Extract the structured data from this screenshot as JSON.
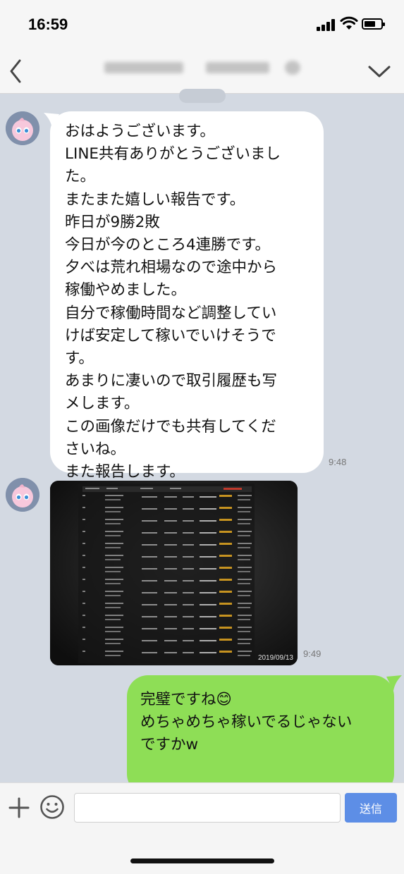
{
  "status_bar": {
    "time": "16:59"
  },
  "header": {
    "back_icon": "chevron-left-icon",
    "menu_icon": "chevron-down-icon"
  },
  "messages": [
    {
      "sender": "other",
      "lines": [
        "おはようございます。",
        "LINE共有ありがとうございまし",
        "た。",
        "またまた嬉しい報告です。",
        "昨日が9勝2敗",
        "今日が今のところ4連勝です。",
        "夕べは荒れ相場なので途中から",
        "稼働やめました。",
        "自分で稼働時間など調整してい",
        "けば安定して稼いでいけそうで",
        "す。",
        "あまりに凄いので取引履歴も写",
        "メします。",
        "この画像だけでも共有してくだ",
        "さいね。",
        "また報告します。"
      ],
      "time": "9:48"
    },
    {
      "sender": "other",
      "type": "image",
      "image_date": "2019/09/13",
      "time": "9:49"
    },
    {
      "sender": "me",
      "lines": [
        "完璧ですね😊",
        "めちゃめちゃ稼いでるじゃない",
        "ですかw"
      ]
    }
  ],
  "input_bar": {
    "placeholder": "",
    "send_label": "送信",
    "plus_icon": "plus-icon",
    "emoji_icon": "emoji-icon"
  },
  "colors": {
    "chat_background": "#d3d9e2",
    "my_bubble": "#8ede56",
    "other_bubble": "#ffffff",
    "send_button": "#5d8ee6"
  }
}
